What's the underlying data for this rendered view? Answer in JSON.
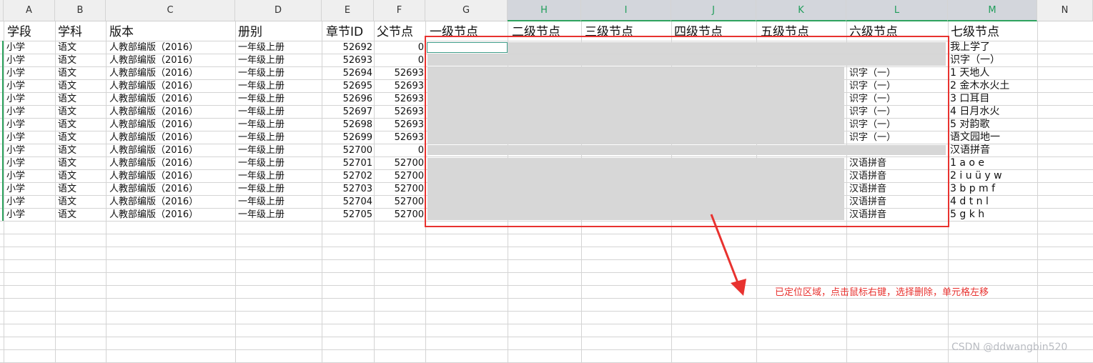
{
  "columns": [
    "A",
    "B",
    "C",
    "D",
    "E",
    "F",
    "G",
    "H",
    "I",
    "J",
    "K",
    "L",
    "M",
    "N"
  ],
  "header_row": [
    "学段",
    "学科",
    "版本",
    "册别",
    "章节ID",
    "父节点",
    "一级节点",
    "二级节点",
    "三级节点",
    "四级节点",
    "五级节点",
    "六级节点",
    "七级节点"
  ],
  "rows": [
    [
      "小学",
      "语文",
      "人教部编版（2016）",
      "一年级上册",
      "52692",
      "0",
      "",
      "我上学了"
    ],
    [
      "小学",
      "语文",
      "人教部编版（2016）",
      "一年级上册",
      "52693",
      "0",
      "",
      "识字（一）"
    ],
    [
      "小学",
      "语文",
      "人教部编版（2016）",
      "一年级上册",
      "52694",
      "52693",
      "识字（一）",
      "1 天地人"
    ],
    [
      "小学",
      "语文",
      "人教部编版（2016）",
      "一年级上册",
      "52695",
      "52693",
      "识字（一）",
      "2 金木水火土"
    ],
    [
      "小学",
      "语文",
      "人教部编版（2016）",
      "一年级上册",
      "52696",
      "52693",
      "识字（一）",
      "3 口耳目"
    ],
    [
      "小学",
      "语文",
      "人教部编版（2016）",
      "一年级上册",
      "52697",
      "52693",
      "识字（一）",
      "4 日月水火"
    ],
    [
      "小学",
      "语文",
      "人教部编版（2016）",
      "一年级上册",
      "52698",
      "52693",
      "识字（一）",
      "5 对韵歌"
    ],
    [
      "小学",
      "语文",
      "人教部编版（2016）",
      "一年级上册",
      "52699",
      "52693",
      "识字（一）",
      "语文园地一"
    ],
    [
      "小学",
      "语文",
      "人教部编版（2016）",
      "一年级上册",
      "52700",
      "0",
      "",
      "汉语拼音"
    ],
    [
      "小学",
      "语文",
      "人教部编版（2016）",
      "一年级上册",
      "52701",
      "52700",
      "汉语拼音",
      "1 a o e"
    ],
    [
      "小学",
      "语文",
      "人教部编版（2016）",
      "一年级上册",
      "52702",
      "52700",
      "汉语拼音",
      "2 i u ü y w"
    ],
    [
      "小学",
      "语文",
      "人教部编版（2016）",
      "一年级上册",
      "52703",
      "52700",
      "汉语拼音",
      "3 b p m f"
    ],
    [
      "小学",
      "语文",
      "人教部编版（2016）",
      "一年级上册",
      "52704",
      "52700",
      "汉语拼音",
      "4 d t n l"
    ],
    [
      "小学",
      "语文",
      "人教部编版（2016）",
      "一年级上册",
      "52705",
      "52700",
      "汉语拼音",
      "5 g k h"
    ]
  ],
  "annotation": "已定位区域，点击鼠标右键，选择删除，单元格左移",
  "watermark": "CSDN @ddwangbin520",
  "colors": {
    "selection_border": "#e8322f",
    "located_fill": "#d7d7d7",
    "header_selected_text": "#1f9d5a"
  }
}
